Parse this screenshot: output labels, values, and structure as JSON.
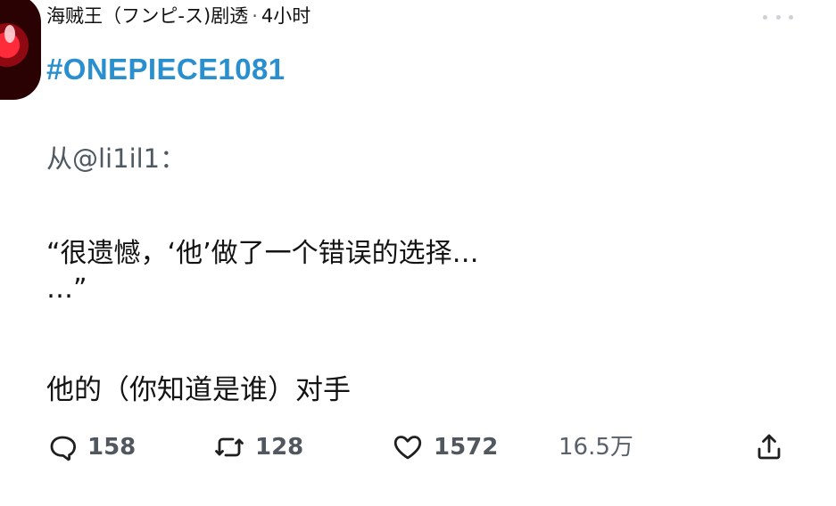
{
  "header": {
    "account_name": "海贼王（フンピ-ス)剧透",
    "separator": "·",
    "time": "4小时"
  },
  "post": {
    "hashtag": "#ONEPIECE1081",
    "source": "从@li1il1：",
    "quote_line_1": "“很遗憾，‘他’做了一个错误的选择…",
    "quote_line_2": "…”",
    "answer": "他的（你知道是谁）对手"
  },
  "actions": {
    "reply_count": "158",
    "retweet_count": "128",
    "like_count": "1572",
    "views": "16.5万"
  },
  "icons": {
    "reply": "reply-icon",
    "retweet": "retweet-icon",
    "like": "heart-icon",
    "share": "share-icon",
    "more": "more-icon"
  },
  "colors": {
    "hashtag": "#2a8fcf",
    "text": "#131313",
    "secondary": "#50575f",
    "avatar_red": "#ff2a3a"
  }
}
